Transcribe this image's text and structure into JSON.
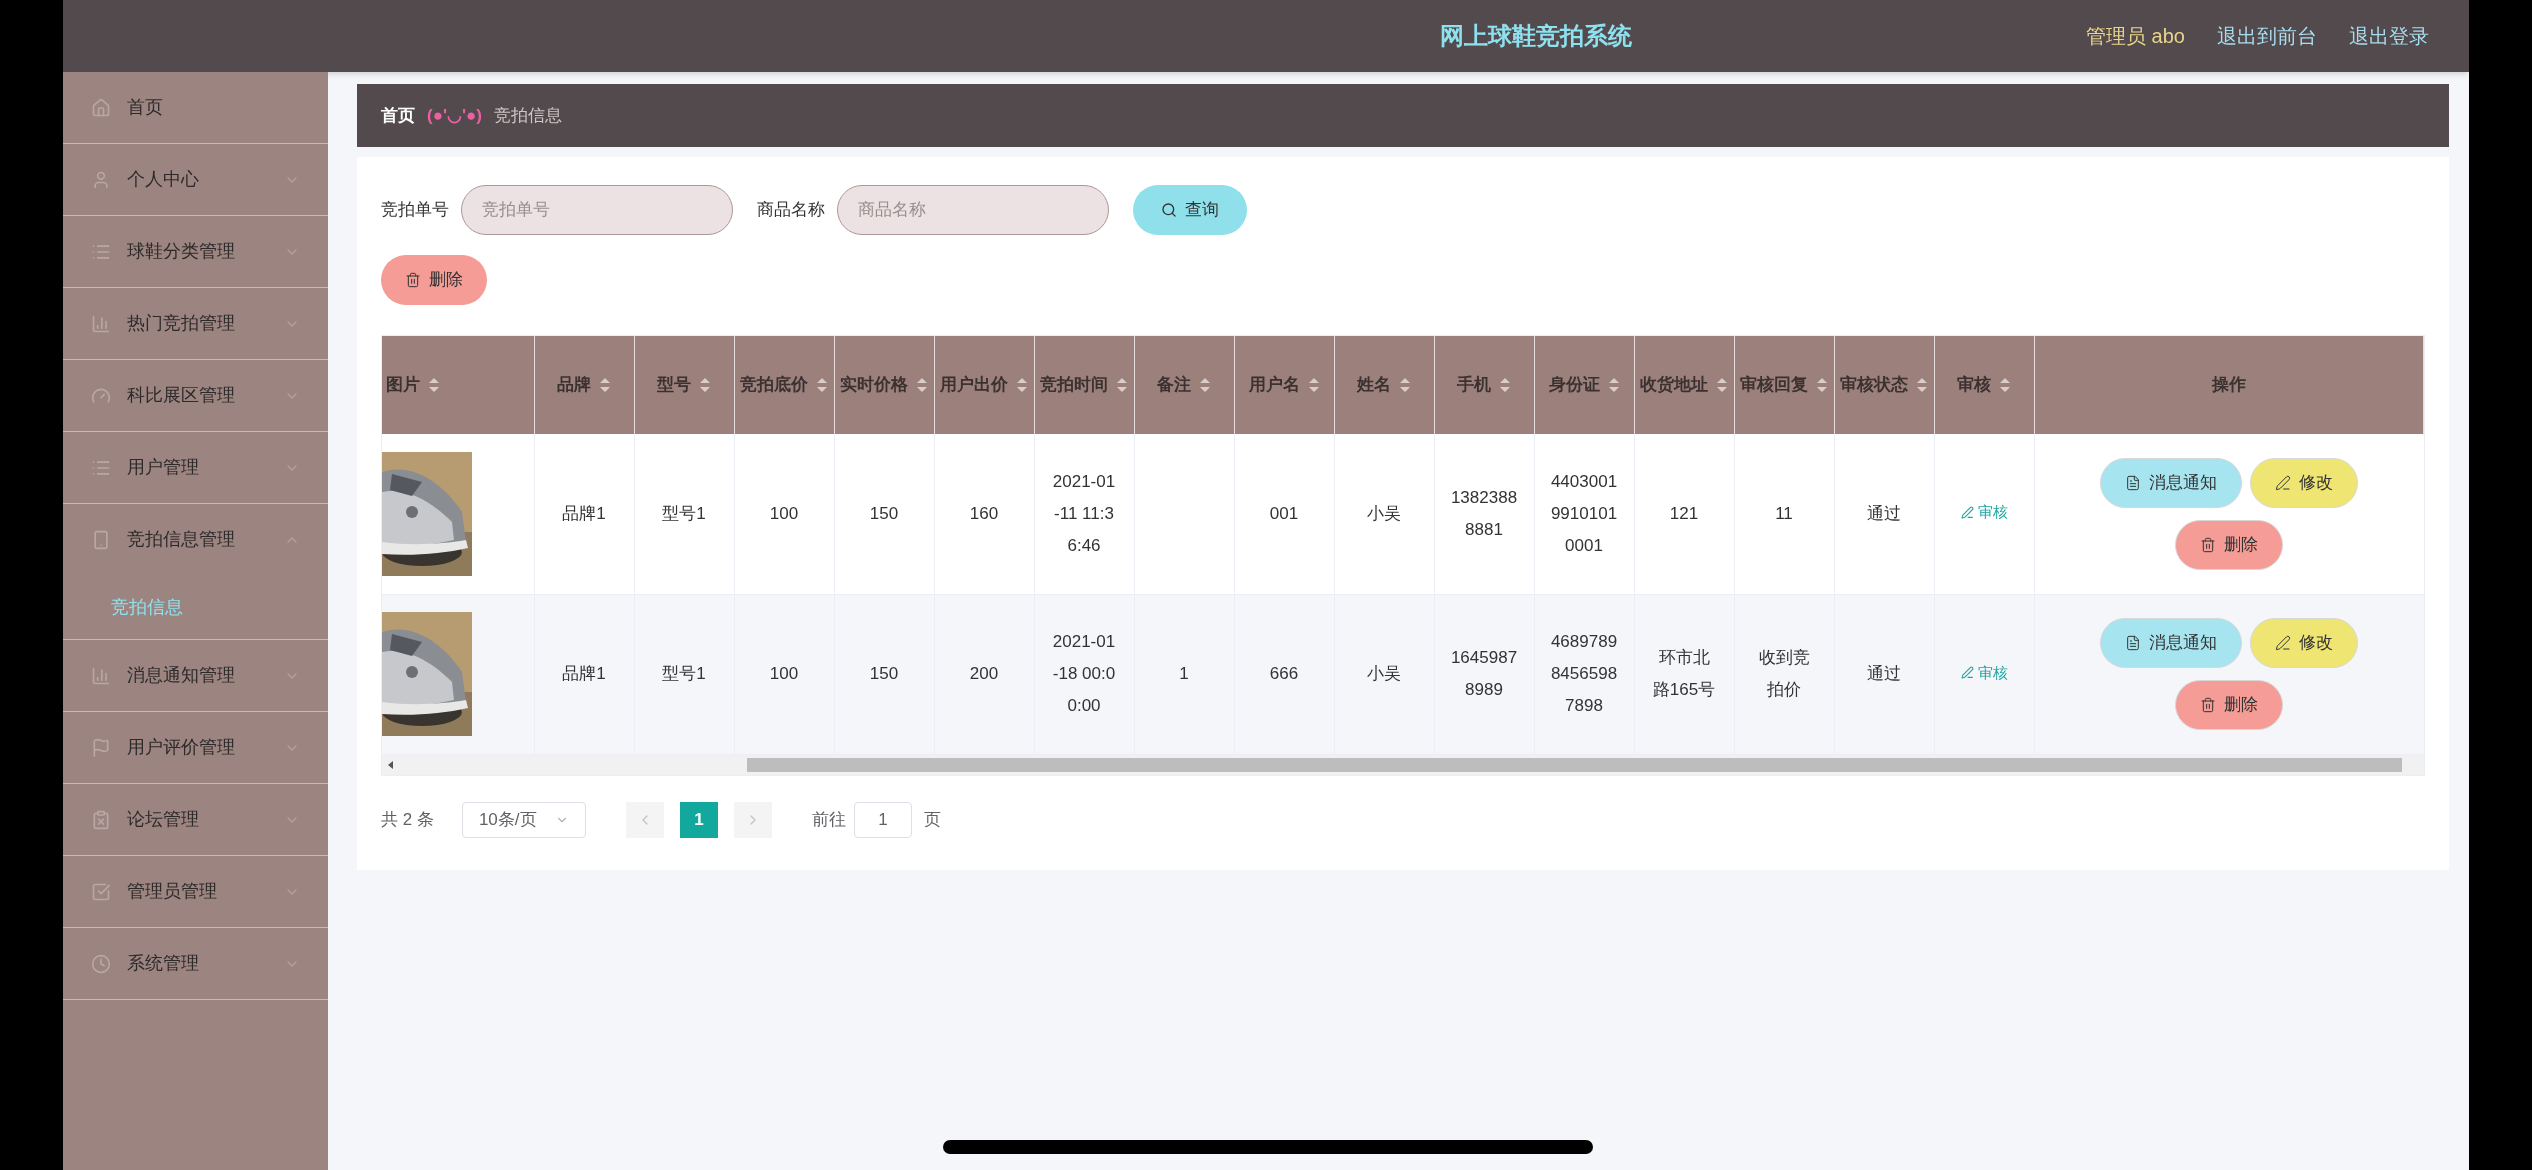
{
  "header": {
    "title": "网上球鞋竞拍系统",
    "user": "管理员 abo",
    "links": [
      "退出到前台",
      "退出登录"
    ]
  },
  "sidebar": {
    "items": [
      {
        "label": "首页",
        "kind": "link"
      },
      {
        "label": "个人中心",
        "kind": "menu",
        "expanded": false
      },
      {
        "label": "球鞋分类管理",
        "kind": "menu",
        "expanded": false
      },
      {
        "label": "热门竞拍管理",
        "kind": "menu",
        "expanded": false
      },
      {
        "label": "科比展区管理",
        "kind": "menu",
        "expanded": false
      },
      {
        "label": "用户管理",
        "kind": "menu",
        "expanded": false
      },
      {
        "label": "竞拍信息管理",
        "kind": "menu",
        "expanded": true,
        "children": [
          {
            "label": "竞拍信息",
            "selected": true
          }
        ]
      },
      {
        "label": "消息通知管理",
        "kind": "menu",
        "expanded": false
      },
      {
        "label": "用户评价管理",
        "kind": "menu",
        "expanded": false
      },
      {
        "label": "论坛管理",
        "kind": "menu",
        "expanded": false
      },
      {
        "label": "管理员管理",
        "kind": "menu",
        "expanded": false
      },
      {
        "label": "系统管理",
        "kind": "menu",
        "expanded": false
      }
    ]
  },
  "breadcrumb": {
    "home": "首页",
    "separator": "(●'◡'●)",
    "current": "竞拍信息"
  },
  "search": {
    "fields": [
      {
        "label": "竞拍单号",
        "placeholder": "竞拍单号"
      },
      {
        "label": "商品名称",
        "placeholder": "商品名称"
      }
    ],
    "button": "查询"
  },
  "delete_button": "删除",
  "table": {
    "columns": [
      {
        "label": "图片",
        "sortable": true
      },
      {
        "label": "品牌",
        "sortable": true
      },
      {
        "label": "型号",
        "sortable": true
      },
      {
        "label": "竞拍底价",
        "sortable": true
      },
      {
        "label": "实时价格",
        "sortable": true
      },
      {
        "label": "用户出价",
        "sortable": true
      },
      {
        "label": "竞拍时间",
        "sortable": true
      },
      {
        "label": "备注",
        "sortable": true
      },
      {
        "label": "用户名",
        "sortable": true
      },
      {
        "label": "姓名",
        "sortable": true
      },
      {
        "label": "手机",
        "sortable": true
      },
      {
        "label": "身份证",
        "sortable": true
      },
      {
        "label": "收货地址",
        "sortable": true
      },
      {
        "label": "审核回复",
        "sortable": true
      },
      {
        "label": "审核状态",
        "sortable": true
      },
      {
        "label": "审核",
        "sortable": true
      },
      {
        "label": "操作",
        "sortable": false
      }
    ],
    "rows": [
      {
        "cells": [
          {
            "kind": "picture"
          },
          {
            "kind": "text",
            "text": "品牌1"
          },
          {
            "kind": "text",
            "text": "型号1"
          },
          {
            "kind": "text",
            "text": "100"
          },
          {
            "kind": "text",
            "text": "150"
          },
          {
            "kind": "text",
            "text": "160"
          },
          {
            "kind": "text",
            "text": "2021-01-11 11:36:46"
          },
          {
            "kind": "text",
            "text": ""
          },
          {
            "kind": "text",
            "text": "001"
          },
          {
            "kind": "text",
            "text": "小吴"
          },
          {
            "kind": "text",
            "text": "13823888881"
          },
          {
            "kind": "text",
            "text": "440300199101010001"
          },
          {
            "kind": "text",
            "text": "121"
          },
          {
            "kind": "text",
            "text": "11"
          },
          {
            "kind": "text",
            "text": "通过"
          },
          {
            "kind": "link",
            "text": "审核"
          },
          {
            "kind": "actions",
            "buttons": [
              "消息通知",
              "修改",
              "删除"
            ]
          }
        ]
      },
      {
        "cells": [
          {
            "kind": "picture"
          },
          {
            "kind": "text",
            "text": "品牌1"
          },
          {
            "kind": "text",
            "text": "型号1"
          },
          {
            "kind": "text",
            "text": "100"
          },
          {
            "kind": "text",
            "text": "150"
          },
          {
            "kind": "text",
            "text": "200"
          },
          {
            "kind": "text",
            "text": "2021-01-18 00:00:00"
          },
          {
            "kind": "text",
            "text": "1"
          },
          {
            "kind": "text",
            "text": "666"
          },
          {
            "kind": "text",
            "text": "小吴"
          },
          {
            "kind": "text",
            "text": "16459878989"
          },
          {
            "kind": "text",
            "text": "468978984565987898"
          },
          {
            "kind": "text",
            "text": "环市北路165号"
          },
          {
            "kind": "text",
            "text": "收到竞拍价"
          },
          {
            "kind": "text",
            "text": "通过"
          },
          {
            "kind": "link",
            "text": "审核"
          },
          {
            "kind": "actions",
            "buttons": [
              "消息通知",
              "修改",
              "删除"
            ]
          }
        ]
      }
    ]
  },
  "pagination": {
    "total": "共 2 条",
    "page_size": "10条/页",
    "pages": [
      {
        "label": "1",
        "selected": true
      }
    ],
    "goto_label": "前往",
    "goto_value": "1",
    "goto_suffix": "页"
  }
}
